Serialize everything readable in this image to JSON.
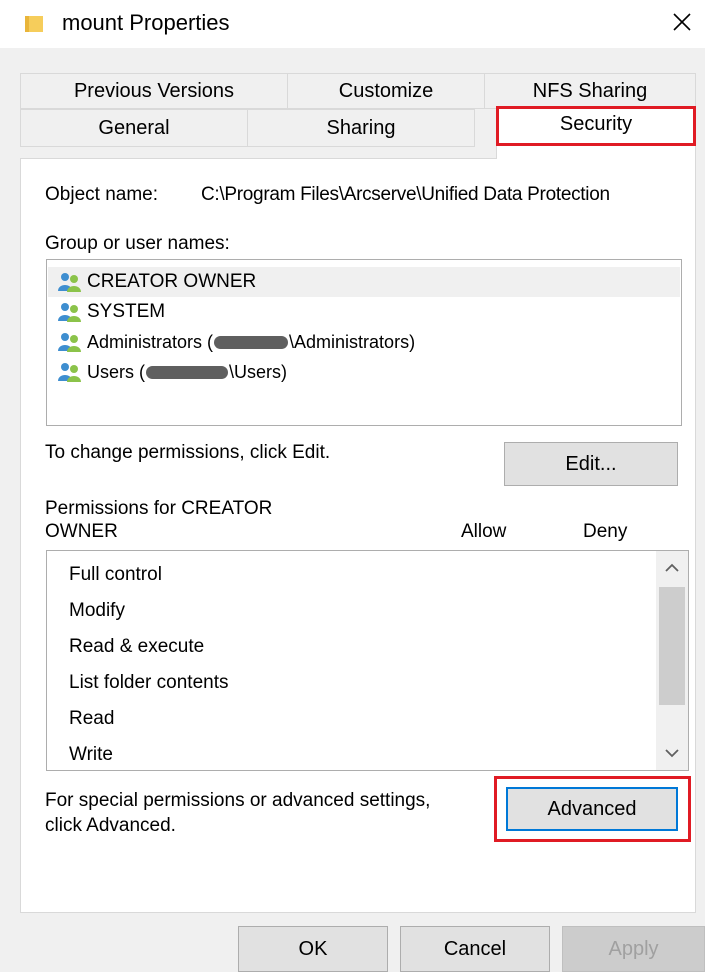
{
  "window": {
    "title": "mount Properties",
    "close_label": "×"
  },
  "tabs_row_top": [
    {
      "label": "Previous Versions"
    },
    {
      "label": "Customize"
    },
    {
      "label": "NFS Sharing"
    }
  ],
  "tabs_row_bottom": [
    {
      "label": "General"
    },
    {
      "label": "Sharing"
    },
    {
      "label": "Security",
      "active": true
    }
  ],
  "security": {
    "object_name_label": "Object name:",
    "object_name_value": "C:\\Program Files\\Arcserve\\Unified Data Protection",
    "group_label": "Group or user names:",
    "users": [
      {
        "name": "CREATOR OWNER",
        "selected": true
      },
      {
        "name": "SYSTEM"
      },
      {
        "name_prefix": "Administrators (",
        "name_suffix": "\\Administrators)"
      },
      {
        "name_prefix": "Users (",
        "name_suffix": "\\Users)"
      }
    ],
    "change_hint": "To change permissions, click Edit.",
    "edit_button": "Edit...",
    "permissions_for_line1": "Permissions for CREATOR",
    "permissions_for_line2": "OWNER",
    "allow_header": "Allow",
    "deny_header": "Deny",
    "permissions": [
      "Full control",
      "Modify",
      "Read & execute",
      "List folder contents",
      "Read",
      "Write"
    ],
    "advanced_hint_line1": "For special permissions or advanced settings,",
    "advanced_hint_line2": "click Advanced.",
    "advanced_button": "Advanced"
  },
  "footer": {
    "ok": "OK",
    "cancel": "Cancel",
    "apply": "Apply"
  },
  "colors": {
    "highlight": "#e01b24",
    "default_button_border": "#0078d7",
    "folder": "#f3c243"
  }
}
